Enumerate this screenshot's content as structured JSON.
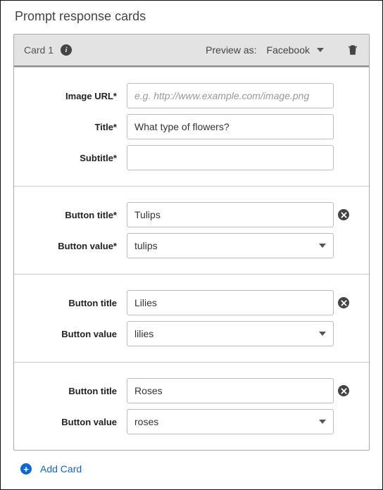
{
  "pageTitle": "Prompt response cards",
  "card": {
    "title": "Card 1",
    "previewLabel": "Preview as:",
    "previewValue": "Facebook",
    "fields": {
      "imageUrl": {
        "label": "Image URL*",
        "value": "",
        "placeholder": "e.g. http://www.example.com/image.png"
      },
      "title": {
        "label": "Title*",
        "value": "What type of flowers?"
      },
      "subtitle": {
        "label": "Subtitle*",
        "value": ""
      }
    },
    "buttons": [
      {
        "titleLabel": "Button title*",
        "valueLabel": "Button value*",
        "title": "Tulips",
        "value": "tulips"
      },
      {
        "titleLabel": "Button title",
        "valueLabel": "Button value",
        "title": "Lilies",
        "value": "lilies"
      },
      {
        "titleLabel": "Button title",
        "valueLabel": "Button value",
        "title": "Roses",
        "value": "roses"
      }
    ]
  },
  "addCardLabel": "Add Card"
}
